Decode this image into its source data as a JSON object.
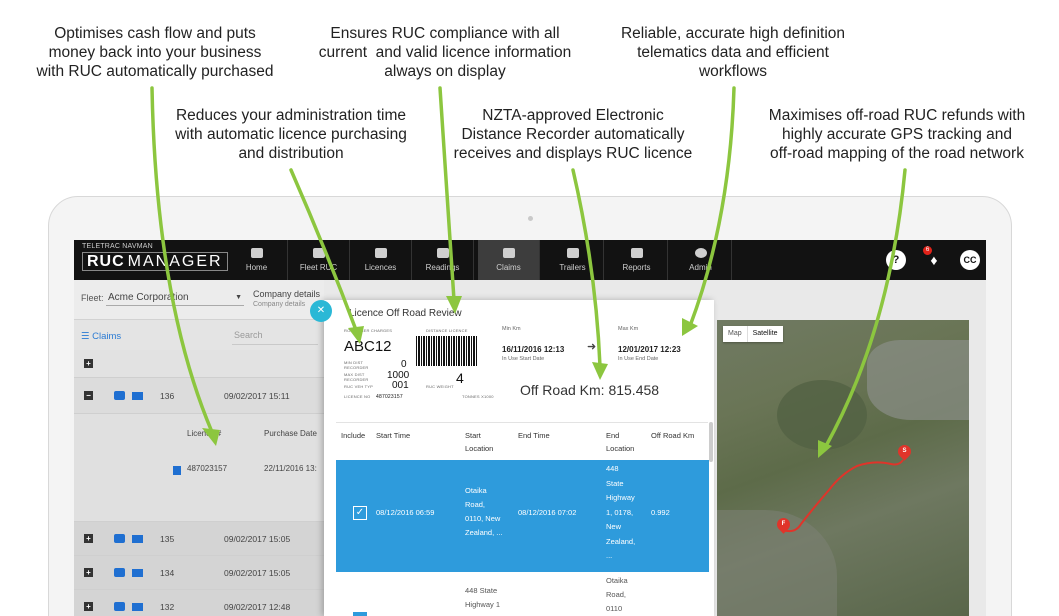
{
  "callouts": {
    "c1": [
      "Optimises cash flow and puts",
      "money back into your business",
      "with RUC automatically purchased"
    ],
    "c2": [
      "Ensures RUC compliance with all",
      "current  and valid licence information",
      "always on display"
    ],
    "c3": [
      "Reliable, accurate high definition",
      "telematics data and efficient",
      "workflows"
    ],
    "c4": [
      "Reduces your administration time",
      "with automatic licence purchasing",
      "and distribution"
    ],
    "c5": [
      "NZTA-approved Electronic",
      "Distance Recorder automatically",
      "receives and displays RUC licence"
    ],
    "c6": [
      "Maximises off-road RUC refunds with",
      "highly accurate GPS tracking and",
      "off-road mapping of the road network"
    ]
  },
  "app": {
    "brand_tagline": "TELETRAC NAVMAN",
    "brand_ruc": "RUC",
    "brand_manager": "MANAGER",
    "nav": [
      "Home",
      "Fleet RUC",
      "Licences",
      "Readings",
      "Claims",
      "Trailers",
      "Reports",
      "Admin"
    ],
    "help_label": "?",
    "bell_badge": "6",
    "avatar_initials": "CC"
  },
  "left": {
    "fleet_label": "Fleet:",
    "fleet_value": "Acme Corporation",
    "company_title": "Company details",
    "company_sub": "Company details",
    "claims_tab": "Claims",
    "search_placeholder": "Search",
    "expanded": {
      "id": "136",
      "date": "09/02/2017 15:11"
    },
    "sub_headers": {
      "licence": "Licence #",
      "purchase": "Purchase Date"
    },
    "sub_row": {
      "licence": "487023157",
      "purchase": "22/11/2016 13:"
    },
    "rows": [
      {
        "id": "135",
        "date": "09/02/2017 15:05"
      },
      {
        "id": "134",
        "date": "09/02/2017 15:05"
      },
      {
        "id": "132",
        "date": "09/02/2017 12:48"
      }
    ]
  },
  "modal": {
    "title": "Licence Off Road Review",
    "licence": {
      "plate": "ABC12",
      "tiny_user_charges": "ROAD USER CHARGES",
      "tiny_distance": "DISTANCE LICENCE",
      "tiny_min": "MIN DIST RECORDER",
      "tiny_max": "MAX DIST RECORDER",
      "tiny_type": "RUC VEH TYP",
      "tiny_licno": "LICENCE NO",
      "tiny_weight": "RUC WEIGHT",
      "tiny_tonnes": "TONNES X1000",
      "min_val": "0",
      "max_val": "1000",
      "type_val": "001",
      "licno_val": "487023157",
      "weight_val": "4"
    },
    "min_km_label": "Min Km",
    "min_km_dt": "16/11/2016 12:13",
    "min_km_sub": "In Use Start Date",
    "max_km_label": "Max Km",
    "max_km_dt": "12/01/2017 12:23",
    "max_km_sub": "In Use End Date",
    "off_road": "Off Road Km: 815.458",
    "headers": {
      "include": "Include",
      "start_time": "Start Time",
      "start_loc_1": "Start",
      "start_loc_2": "Location",
      "end_time": "End Time",
      "end_loc_1": "End",
      "end_loc_2": "Location",
      "off_road_km": "Off Road Km"
    },
    "row1": {
      "check": "✓",
      "start_time": "08/12/2016 06:59",
      "start_loc": [
        "Otaika",
        "Road,",
        "0110, New",
        "Zealand, ..."
      ],
      "end_time": "08/12/2016 07:02",
      "end_loc": [
        "448",
        "State",
        "Highway",
        "1, 0178,",
        "New",
        "Zealand,",
        "..."
      ],
      "km": "0.992"
    },
    "row2": {
      "start_loc": [
        "448 State",
        "Highway 1"
      ],
      "end_loc": [
        "Otaika",
        "Road,",
        "0110"
      ]
    }
  },
  "map": {
    "tab_map": "Map",
    "tab_satellite": "Satellite",
    "pin_start": "S",
    "pin_finish": "F"
  }
}
